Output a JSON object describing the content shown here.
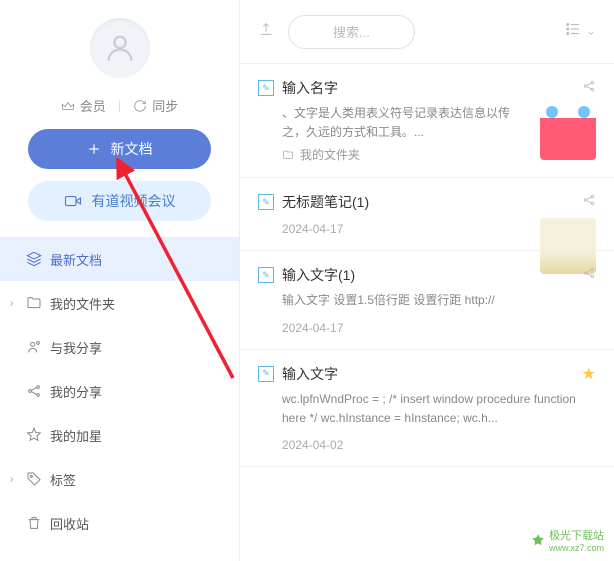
{
  "sidebar": {
    "profile": {
      "member_label": "会员",
      "sync_label": "同步"
    },
    "new_doc_label": "新文档",
    "video_meeting_label": "有道视频会议",
    "nav": [
      {
        "label": "最新文档",
        "icon": "stack-icon",
        "active": true,
        "has_chevron": false
      },
      {
        "label": "我的文件夹",
        "icon": "folder-icon-nav",
        "active": false,
        "has_chevron": true
      },
      {
        "label": "与我分享",
        "icon": "share-with-me-icon",
        "active": false,
        "has_chevron": false
      },
      {
        "label": "我的分享",
        "icon": "my-share-icon",
        "active": false,
        "has_chevron": false
      },
      {
        "label": "我的加星",
        "icon": "star-icon",
        "active": false,
        "has_chevron": false
      },
      {
        "label": "标签",
        "icon": "tag-icon",
        "active": false,
        "has_chevron": true
      },
      {
        "label": "回收站",
        "icon": "trash-icon",
        "active": false,
        "has_chevron": false
      }
    ]
  },
  "topbar": {
    "search_placeholder": "搜索..."
  },
  "notes": [
    {
      "title": "输入名字",
      "preview": "、文字是人类用表义符号记录表达信息以传之，久远的方式和工具。...",
      "folder": "我的文件夹",
      "date": "",
      "has_thumb": "thumb1",
      "action": "share"
    },
    {
      "title": "无标题笔记(1)",
      "preview": "",
      "folder": "",
      "date": "2024-04-17",
      "has_thumb": "thumb2",
      "action": "share"
    },
    {
      "title": "输入文字(1)",
      "preview": "输入文字 设置1.5倍行距 设置行距 http://",
      "folder": "",
      "date": "2024-04-17",
      "has_thumb": "",
      "action": "share"
    },
    {
      "title": "输入文字",
      "preview": "wc.lpfnWndProc = ; /* insert window procedure function here */ wc.hInstance = hInstance; wc.h...",
      "folder": "",
      "date": "2024-04-02",
      "has_thumb": "",
      "action": "star"
    }
  ],
  "watermark": {
    "name": "极光下载站",
    "url": "www.xz7.com"
  }
}
